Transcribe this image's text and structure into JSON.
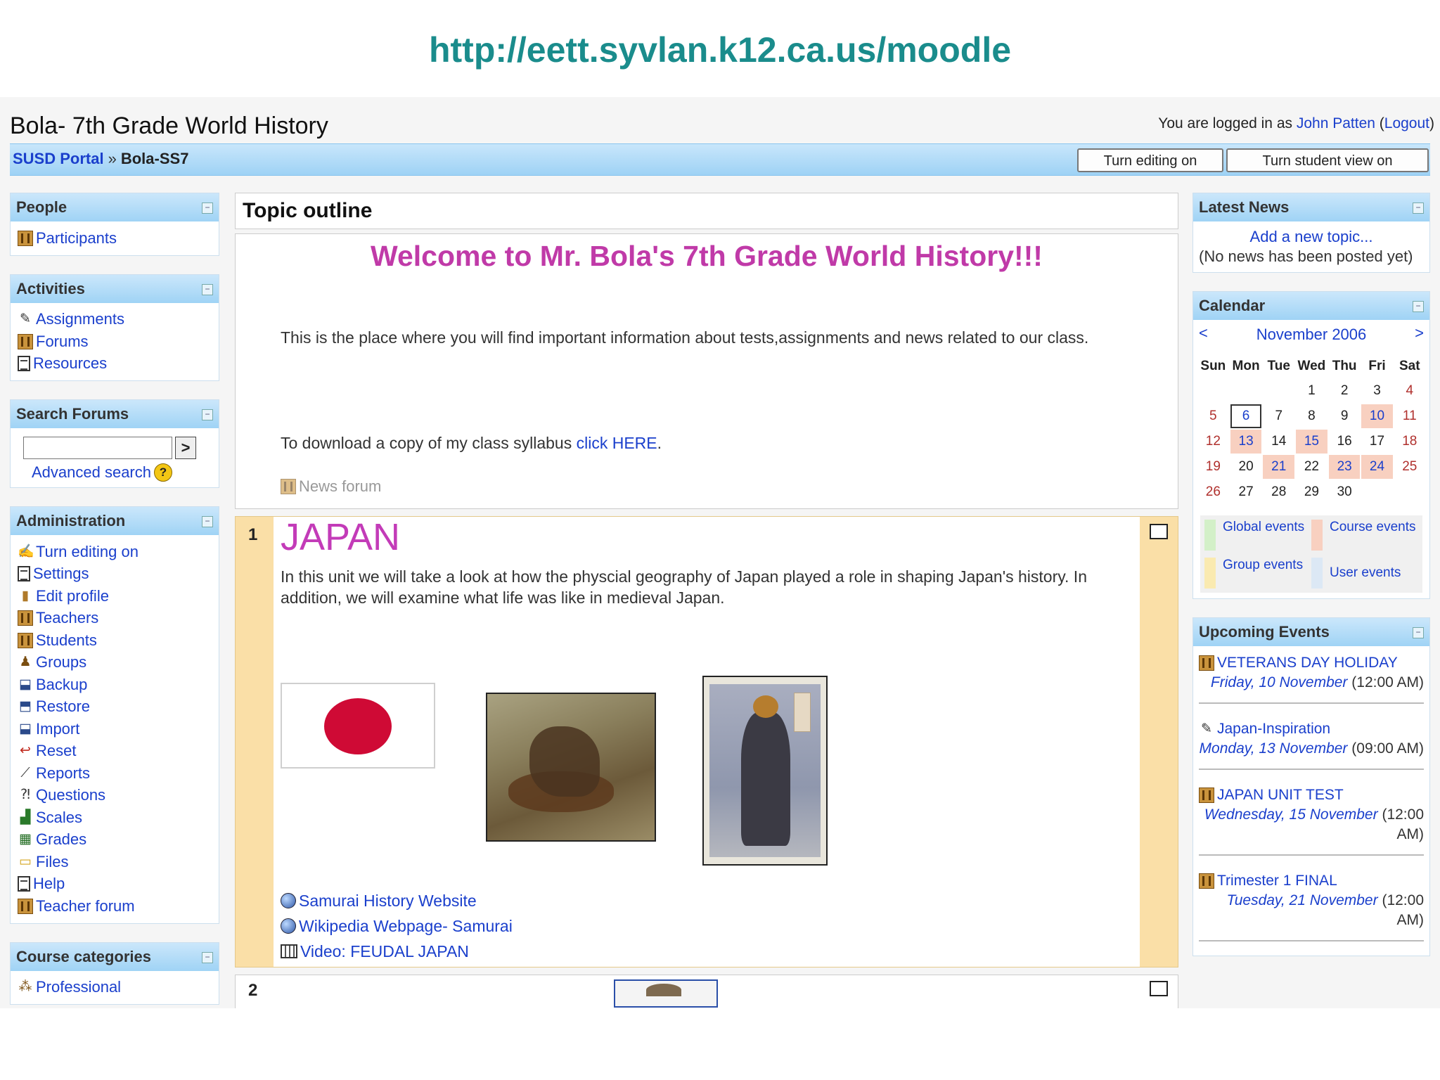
{
  "slide_url": "http://eett.syvlan.k12.ca.us/moodle",
  "site": {
    "title": "Bola- 7th Grade World History",
    "login_prefix": "You are logged in as",
    "user": "John Patten",
    "logout": "Logout",
    "breadcrumb": [
      "SUSD Portal",
      "Bola-SS7"
    ],
    "breadcrumb_sep": "»",
    "btn_editing": "Turn editing on",
    "btn_student_view": "Turn student view on"
  },
  "left": {
    "people": {
      "title": "People",
      "items": [
        "Participants"
      ]
    },
    "activities": {
      "title": "Activities",
      "items": [
        "Assignments",
        "Forums",
        "Resources"
      ]
    },
    "search": {
      "title": "Search Forums",
      "go": ">",
      "advanced": "Advanced search",
      "help": "?"
    },
    "admin": {
      "title": "Administration",
      "items": [
        "Turn editing on",
        "Settings",
        "Edit profile",
        "Teachers",
        "Students",
        "Groups",
        "Backup",
        "Restore",
        "Import",
        "Reset",
        "Reports",
        "Questions",
        "Scales",
        "Grades",
        "Files",
        "Help",
        "Teacher forum"
      ]
    },
    "categories": {
      "title": "Course categories",
      "items": [
        "Professional"
      ]
    }
  },
  "main": {
    "topic_outline": "Topic outline",
    "welcome": "Welcome to Mr. Bola's 7th Grade World History!!!",
    "intro": "This is the place where you will find important information about tests,assignments and news related to our class.",
    "syllabus_prefix": "To download a copy of my class syllabus",
    "syllabus_link": "click HERE",
    "syllabus_suffix": ".",
    "news_forum": "News forum",
    "section1": {
      "num": "1",
      "title": "JAPAN",
      "desc": "In this unit we will take a look at how the physcial geography of Japan played a role in shaping Japan's history. In addition, we will examine what life was like in medieval Japan.",
      "links": [
        "Samurai History Website",
        "Wikipedia Webpage- Samurai",
        "Video: FEUDAL JAPAN"
      ]
    },
    "section2": {
      "num": "2"
    }
  },
  "right": {
    "news": {
      "title": "Latest News",
      "add": "Add a new topic...",
      "empty": "(No news has been posted yet)"
    },
    "calendar": {
      "title": "Calendar",
      "prev": "<",
      "next": ">",
      "month": "November 2006",
      "days": [
        "Sun",
        "Mon",
        "Tue",
        "Wed",
        "Thu",
        "Fri",
        "Sat"
      ],
      "weeks": [
        [
          "",
          "",
          "",
          "1",
          "2",
          "3",
          "4"
        ],
        [
          "5",
          "6",
          "7",
          "8",
          "9",
          "10",
          "11"
        ],
        [
          "12",
          "13",
          "14",
          "15",
          "16",
          "17",
          "18"
        ],
        [
          "19",
          "20",
          "21",
          "22",
          "23",
          "24",
          "25"
        ],
        [
          "26",
          "27",
          "28",
          "29",
          "30",
          "",
          ""
        ]
      ],
      "today": "6",
      "event_days": [
        "10",
        "13",
        "15",
        "21",
        "23",
        "24"
      ],
      "legend": [
        "Global events",
        "Course events",
        "Group events",
        "User events"
      ],
      "legend_colors": [
        "#d3f0c8",
        "#f8d0c0",
        "#faeab0",
        "#dce8f5"
      ]
    },
    "upcoming": {
      "title": "Upcoming Events",
      "events": [
        {
          "title": "VETERANS DAY HOLIDAY",
          "date": "Friday, 10 November",
          "time": "(12:00 AM)"
        },
        {
          "title": "Japan-Inspiration",
          "date": "Monday, 13 November",
          "time": "(09:00 AM)"
        },
        {
          "title": "JAPAN UNIT TEST",
          "date": "Wednesday, 15 November",
          "time": "(12:00 AM)"
        },
        {
          "title": "Trimester 1 FINAL",
          "date": "Tuesday, 21 November",
          "time": "(12:00 AM)"
        }
      ]
    }
  },
  "icons": {
    "hide_block": "minus-icon",
    "people": "people-icon",
    "document": "document-icon",
    "web": "globe-icon",
    "video": "video-icon"
  }
}
